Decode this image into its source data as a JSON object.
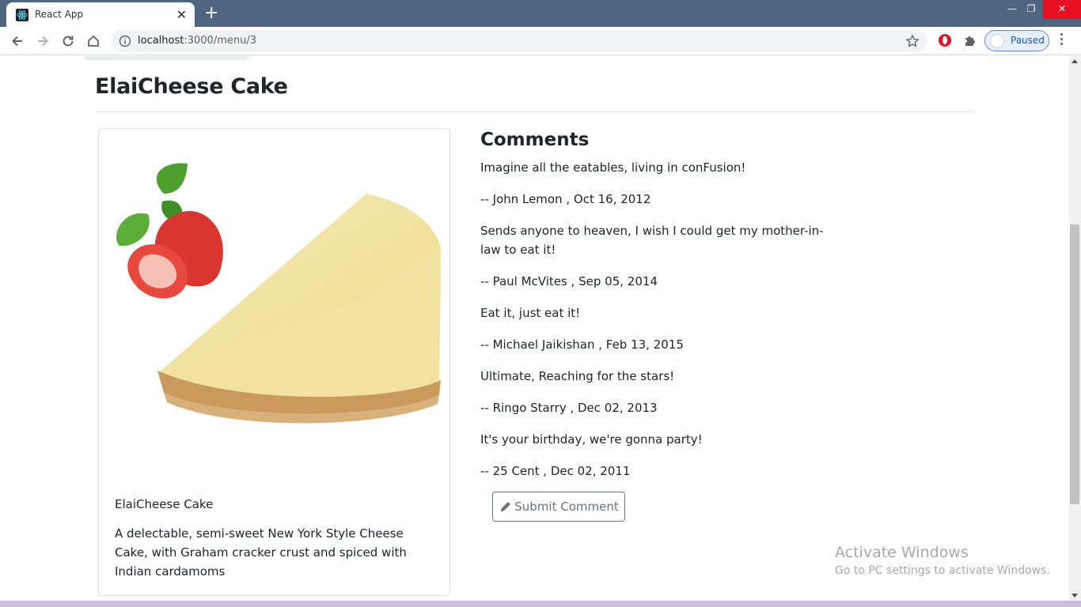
{
  "browser": {
    "tab_title": "React App",
    "tab_close": "✕",
    "new_tab": "+",
    "url_host": "localhost",
    "url_path": ":3000/menu/3",
    "profile_label": "Paused",
    "win_min": "—",
    "win_restore": "❐",
    "win_close": "✕"
  },
  "dish": {
    "page_title": "ElaiCheese Cake",
    "name": "ElaiCheese Cake",
    "description": "A delectable, semi-sweet New York Style Cheese Cake, with Graham cracker crust and spiced with Indian cardamoms"
  },
  "comments": {
    "heading": "Comments",
    "items": [
      {
        "text": "Imagine all the eatables, living in conFusion!",
        "byline": "-- John Lemon , Oct 16, 2012"
      },
      {
        "text": "Sends anyone to heaven, I wish I could get my mother-in-law to eat it!",
        "byline": "-- Paul McVites , Sep 05, 2014"
      },
      {
        "text": "Eat it, just eat it!",
        "byline": "-- Michael Jaikishan , Feb 13, 2015"
      },
      {
        "text": "Ultimate, Reaching for the stars!",
        "byline": "-- Ringo Starry , Dec 02, 2013"
      },
      {
        "text": "It's your birthday, we're gonna party!",
        "byline": "-- 25 Cent , Dec 02, 2011"
      }
    ],
    "submit_label": "Submit Comment"
  },
  "os": {
    "activate_title": "Activate Windows",
    "activate_sub": "Go to PC settings to activate Windows."
  }
}
